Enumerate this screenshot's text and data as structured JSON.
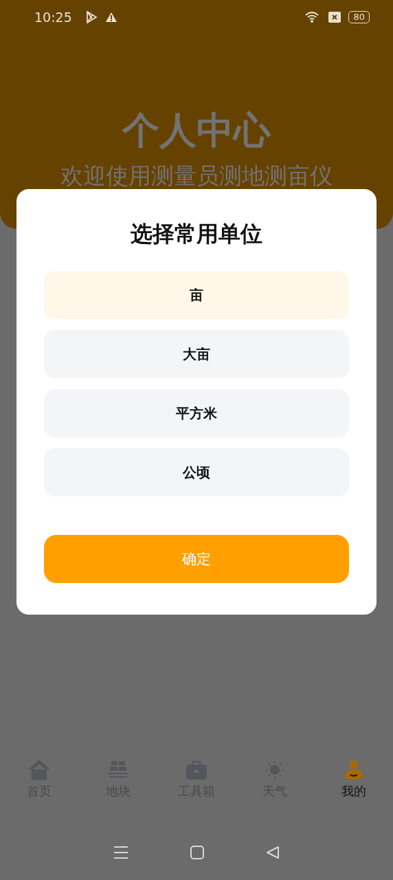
{
  "status_bar": {
    "time": "10:25",
    "battery": "80"
  },
  "header": {
    "title": "个人中心",
    "subtitle": "欢迎使用测量员测地测亩仪"
  },
  "dialog": {
    "title": "选择常用单位",
    "options": [
      {
        "label": "亩",
        "selected": true
      },
      {
        "label": "大亩",
        "selected": false
      },
      {
        "label": "平方米",
        "selected": false
      },
      {
        "label": "公顷",
        "selected": false
      }
    ],
    "confirm": "确定"
  },
  "tabs": [
    {
      "kind": "home",
      "label": "首页",
      "selected": false
    },
    {
      "kind": "plots",
      "label": "地块",
      "selected": false
    },
    {
      "kind": "toolbox",
      "label": "工具箱",
      "selected": false
    },
    {
      "kind": "weather",
      "label": "天气",
      "selected": false
    },
    {
      "kind": "profile",
      "label": "我的",
      "selected": true
    }
  ]
}
